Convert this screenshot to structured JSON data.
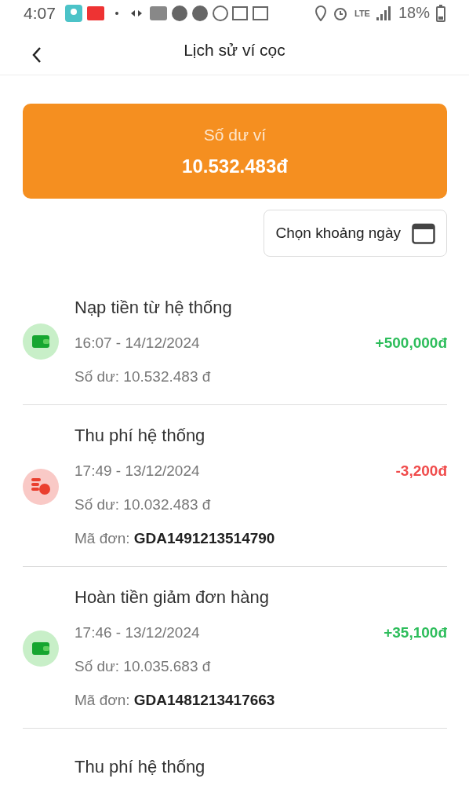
{
  "status_bar": {
    "time": "4:07",
    "battery": "18%",
    "network": "LTE"
  },
  "header": {
    "title": "Lịch sử ví cọc"
  },
  "balance_card": {
    "label": "Số dư ví",
    "amount": "10.532.483đ"
  },
  "date_filter": {
    "label": "Chọn khoảng ngày"
  },
  "transactions": [
    {
      "kind": "credit",
      "title": "Nạp tiền từ hệ thống",
      "time": "16:07 - 14/12/2024",
      "amount": "+500,000đ",
      "balance": "Số dư: 10.532.483 đ"
    },
    {
      "kind": "debit",
      "title": "Thu phí hệ thống",
      "time": "17:49 - 13/12/2024",
      "amount": "-3,200đ",
      "balance": "Số dư: 10.032.483 đ",
      "order_label": "Mã đơn:",
      "order_code": "GDA1491213514790"
    },
    {
      "kind": "credit",
      "title": "Hoàn tiền giảm đơn hàng",
      "time": "17:46 - 13/12/2024",
      "amount": "+35,100đ",
      "balance": "Số dư: 10.035.683 đ",
      "order_label": "Mã đơn:",
      "order_code": "GDA1481213417663"
    },
    {
      "kind": "debit",
      "title": "Thu phí hệ thống"
    }
  ]
}
